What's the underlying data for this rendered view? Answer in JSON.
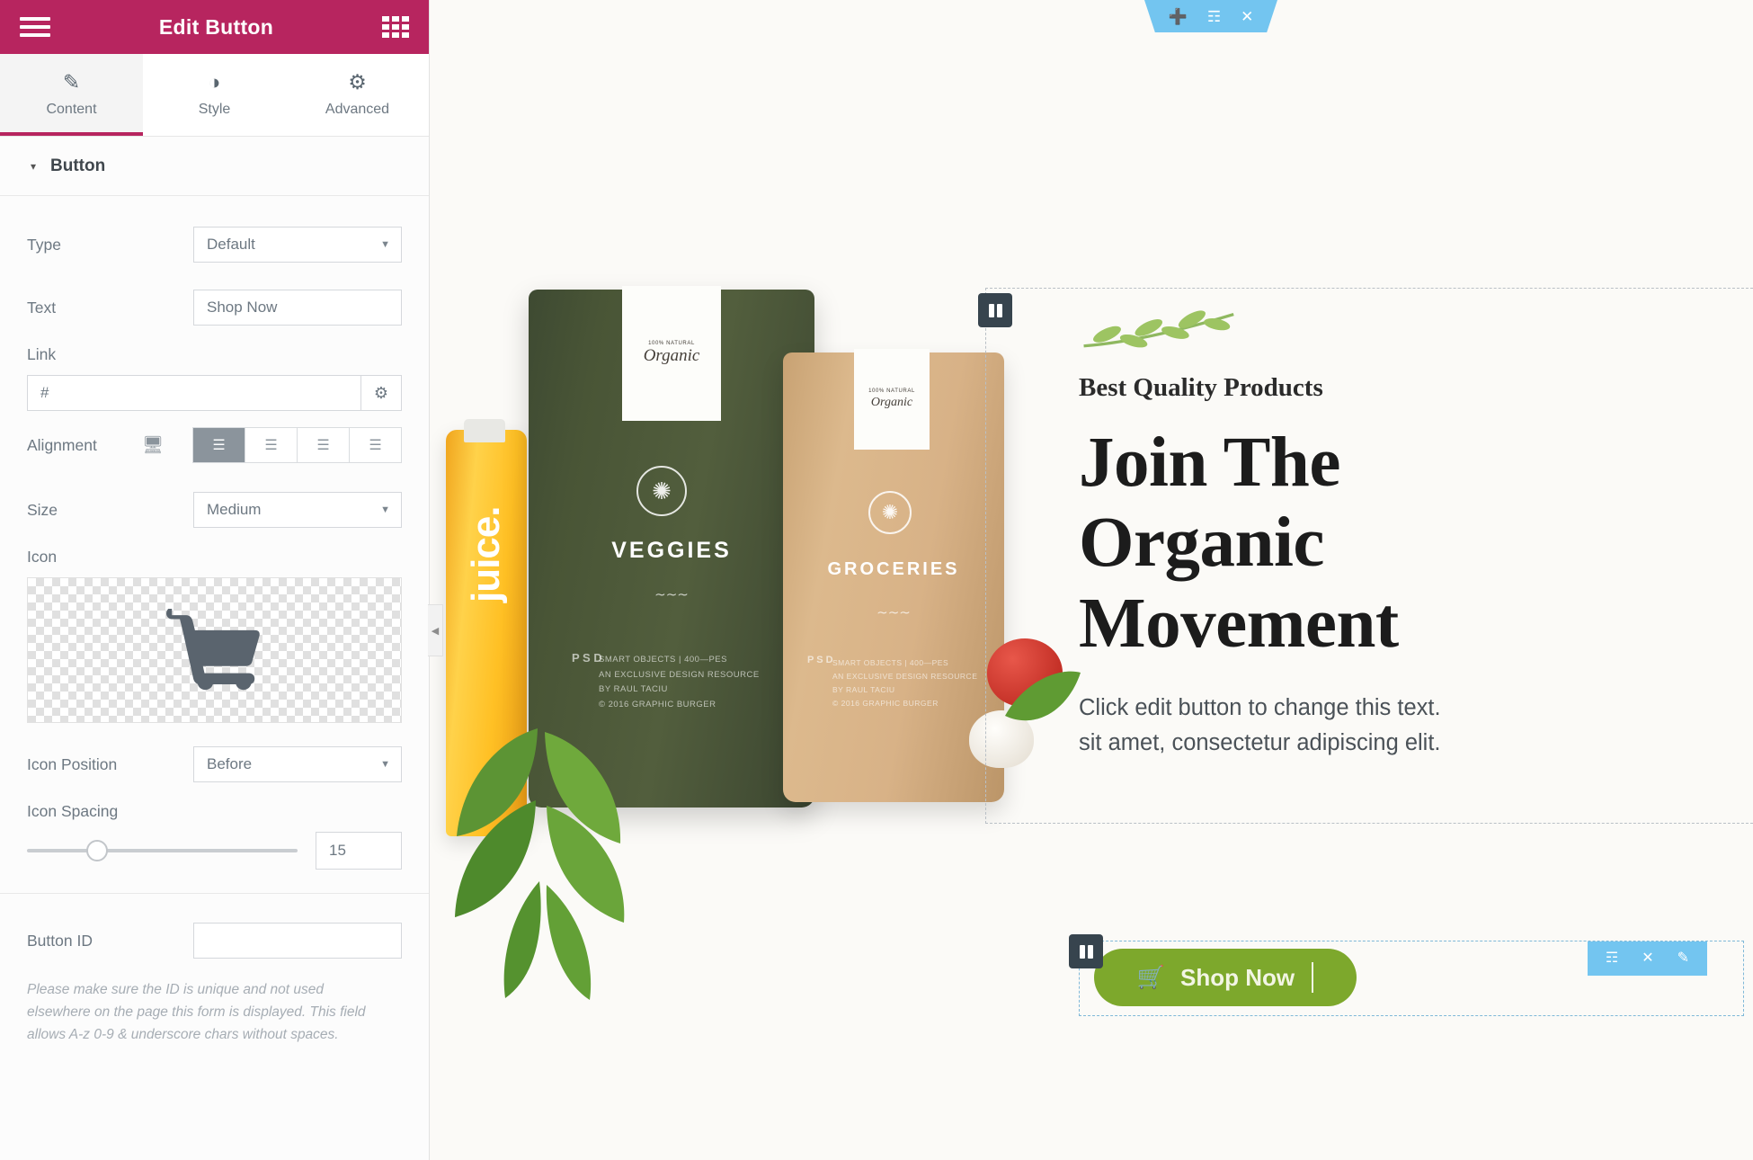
{
  "panel": {
    "header": {
      "title": "Edit Button",
      "menu_icon": "hamburger-icon",
      "apps_icon": "grid-apps-icon"
    },
    "tabs": [
      {
        "label": "Content",
        "icon": "pencil-icon",
        "active": true
      },
      {
        "label": "Style",
        "icon": "contrast-circle-icon",
        "active": false
      },
      {
        "label": "Advanced",
        "icon": "gear-icon",
        "active": false
      }
    ],
    "section": {
      "title": "Button",
      "caret": "▾"
    },
    "fields": {
      "type": {
        "label": "Type",
        "value": "Default"
      },
      "text": {
        "label": "Text",
        "value": "Shop Now"
      },
      "link": {
        "label": "Link",
        "value": "#",
        "gear_icon": "link-options-gear-icon"
      },
      "alignment": {
        "label": "Alignment",
        "device_icon": "desktop-icon",
        "options": [
          "align-left",
          "align-center",
          "align-right",
          "align-justify"
        ],
        "selected_index": 0
      },
      "size": {
        "label": "Size",
        "value": "Medium"
      },
      "icon": {
        "label": "Icon",
        "preview_icon": "shopping-cart-icon"
      },
      "icon_position": {
        "label": "Icon Position",
        "value": "Before"
      },
      "icon_spacing": {
        "label": "Icon Spacing",
        "value": "15"
      },
      "button_id": {
        "label": "Button ID",
        "value": ""
      }
    },
    "help_text": "Please make sure the ID is unique and not used elsewhere on the page this form is displayed. This field allows A-z 0-9 & underscore chars without spaces.",
    "collapse_icon": "chevron-left-icon"
  },
  "canvas": {
    "section_toolbar": {
      "icons": [
        "plus-icon",
        "grid-dots-icon",
        "close-icon"
      ],
      "color": "#73c5f0"
    },
    "column_handle_icon": "column-handle-icon",
    "hero": {
      "branch_icon": "olive-branch-icon",
      "eyebrow": "Best Quality Products",
      "headline_lines": [
        "Join The",
        "Organic",
        "Movement"
      ],
      "paragraph_lines": [
        "Click edit button to change this text.",
        "sit amet, consectetur adipiscing elit."
      ]
    },
    "shop_button": {
      "label": "Shop Now",
      "icon": "shopping-cart-icon",
      "color": "#7da82c",
      "toolbar_icons": [
        "grid-dots-icon",
        "close-icon",
        "pencil-icon"
      ]
    },
    "product_photo": {
      "bag_green": {
        "title": "VEGGIES",
        "logo_small": "100% NATURAL",
        "logo_big": "Organic",
        "psd": "P S D",
        "meta_lines": [
          "SMART OBJECTS  |  400—PES",
          "AN EXCLUSIVE DESIGN RESOURCE",
          "BY RAUL TACIU",
          "© 2016 GRAPHIC BURGER"
        ]
      },
      "bag_kraft": {
        "title": "GROCERIES",
        "logo_small": "100% NATURAL",
        "logo_big": "Organic",
        "psd": "P S D",
        "meta_lines": [
          "SMART OBJECTS  |  400—PES",
          "AN EXCLUSIVE DESIGN RESOURCE",
          "BY RAUL TACIU",
          "© 2016 GRAPHIC BURGER"
        ]
      },
      "bottle_label": "juice."
    }
  }
}
